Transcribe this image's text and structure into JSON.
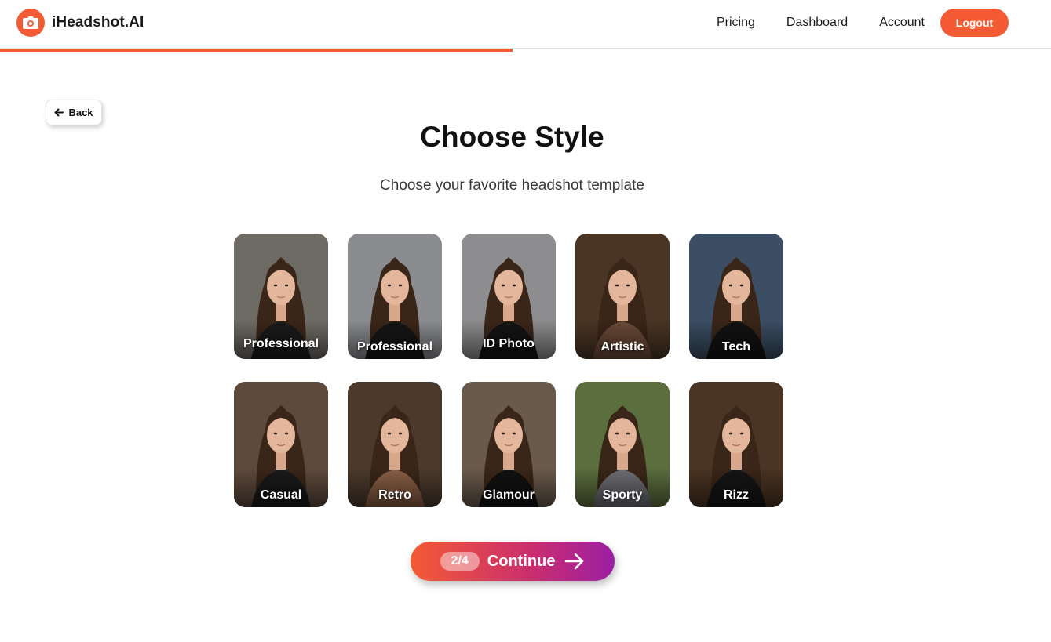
{
  "header": {
    "brand": "iHeadshot.AI",
    "nav": [
      "Pricing",
      "Dashboard",
      "Account"
    ],
    "logout_label": "Logout",
    "progress": 0.5
  },
  "back_label": "Back",
  "title": "Choose Style",
  "subtitle": "Choose your favorite headshot template",
  "styles": [
    {
      "label": "Professional",
      "selected": true,
      "bg": "#6e6a64",
      "clothing": "#1b1b1b"
    },
    {
      "label": "Professional",
      "selected": false,
      "bg": "#8a8c90",
      "clothing": "#161616"
    },
    {
      "label": "ID Photo",
      "selected": true,
      "bg": "#8d8d8f",
      "clothing": "#141414"
    },
    {
      "label": "Artistic",
      "selected": false,
      "bg": "#4a3524",
      "clothing": "#6b4a38"
    },
    {
      "label": "Tech",
      "selected": false,
      "bg": "#3b4e63",
      "clothing": "#121212"
    },
    {
      "label": "Casual",
      "selected": false,
      "bg": "#5d4a3c",
      "clothing": "#1a1a1a"
    },
    {
      "label": "Retro",
      "selected": false,
      "bg": "#4b3a2c",
      "clothing": "#8a5f45"
    },
    {
      "label": "Glamour",
      "selected": false,
      "bg": "#6a5a4c",
      "clothing": "#111111"
    },
    {
      "label": "Sporty",
      "selected": false,
      "bg": "#5b6e3e",
      "clothing": "#6d6e74"
    },
    {
      "label": "Rizz",
      "selected": false,
      "bg": "#4a3423",
      "clothing": "#151515"
    }
  ],
  "continue": {
    "step": "2/4",
    "label": "Continue"
  },
  "colors": {
    "accent": "#f45b34",
    "gradient_end": "#9b1fa4"
  }
}
